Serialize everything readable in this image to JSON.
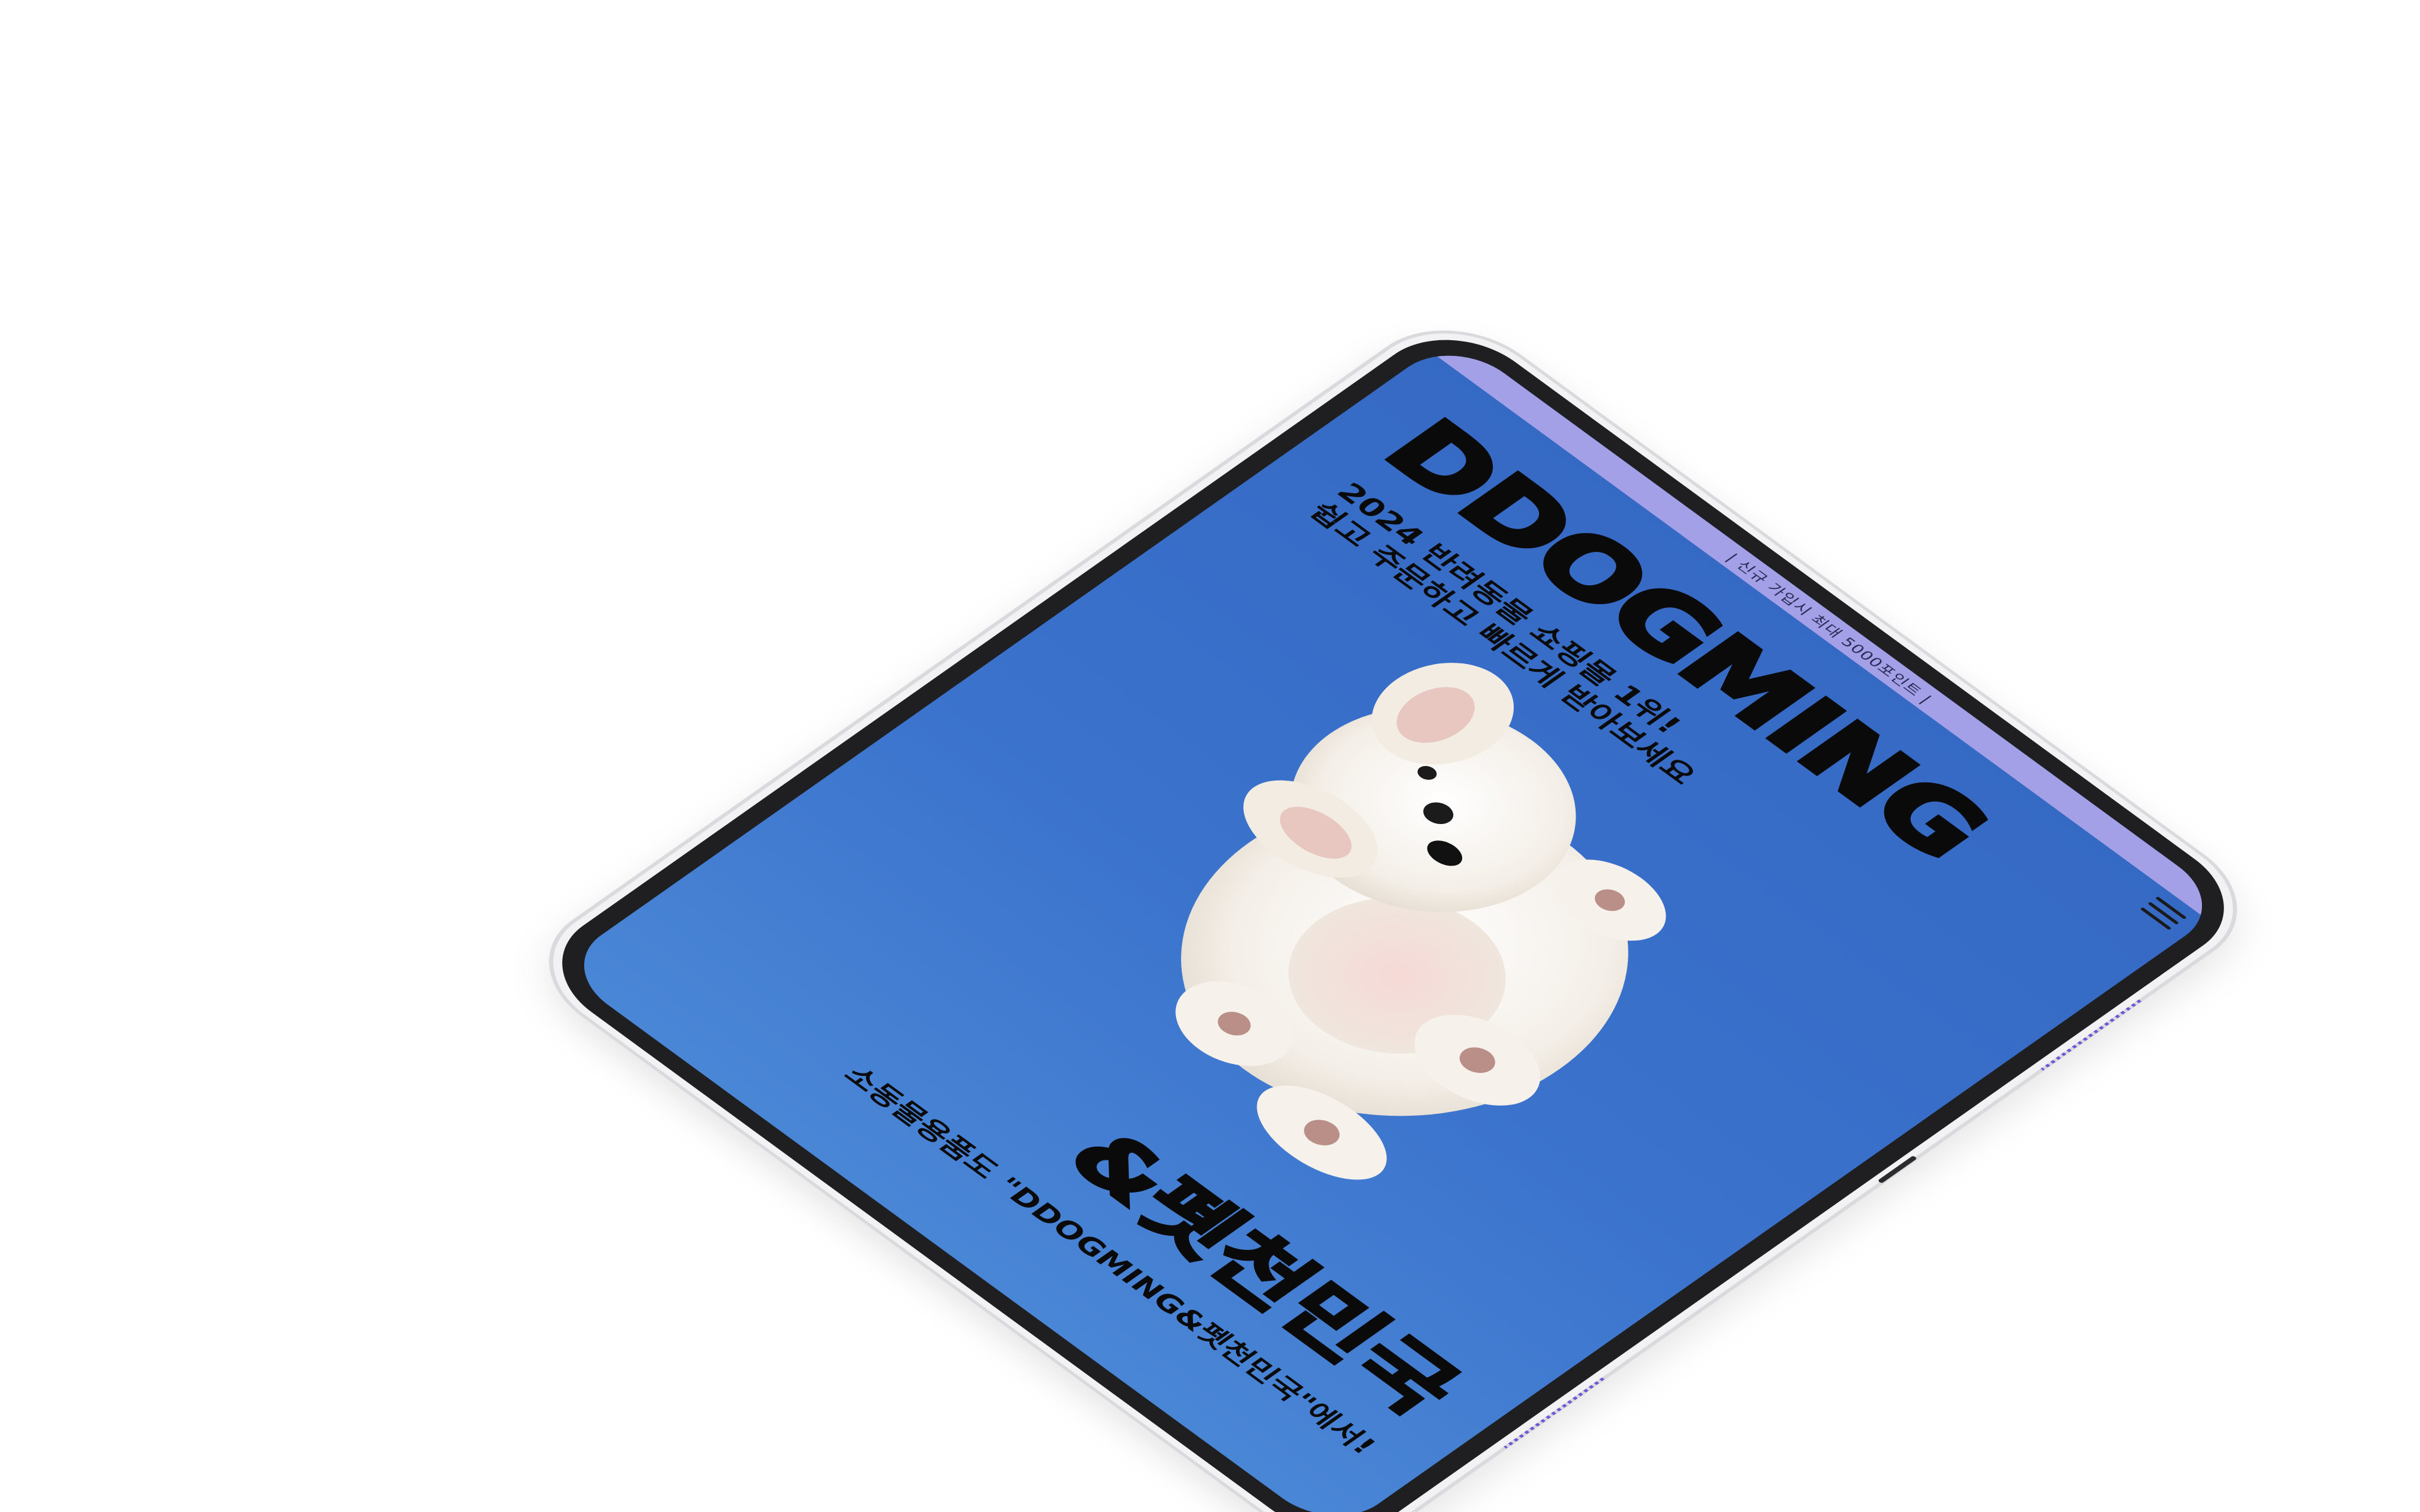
{
  "banner": {
    "text": "| 신규 가입시 최대 5000포인트 |"
  },
  "brand": {
    "title": "DDOGMING"
  },
  "tagline": {
    "line1": "2024 반려동물 쇼핑몰 1위!",
    "line2": "쉽고 주문하고 빠르게 받아보세요"
  },
  "headline": {
    "text": "&펫천민국"
  },
  "subline": {
    "text": "소동물용품도 \"DDOGMING&펫천민국\"에서!"
  },
  "colors": {
    "screen_background": "#3a72cc",
    "banner_background": "#a3a0e8",
    "text": "#0a0a0a",
    "device_shell": "#f2f2f4",
    "bezel": "#1f1f22"
  },
  "icons": {
    "menu": "hamburger-menu-icon"
  }
}
